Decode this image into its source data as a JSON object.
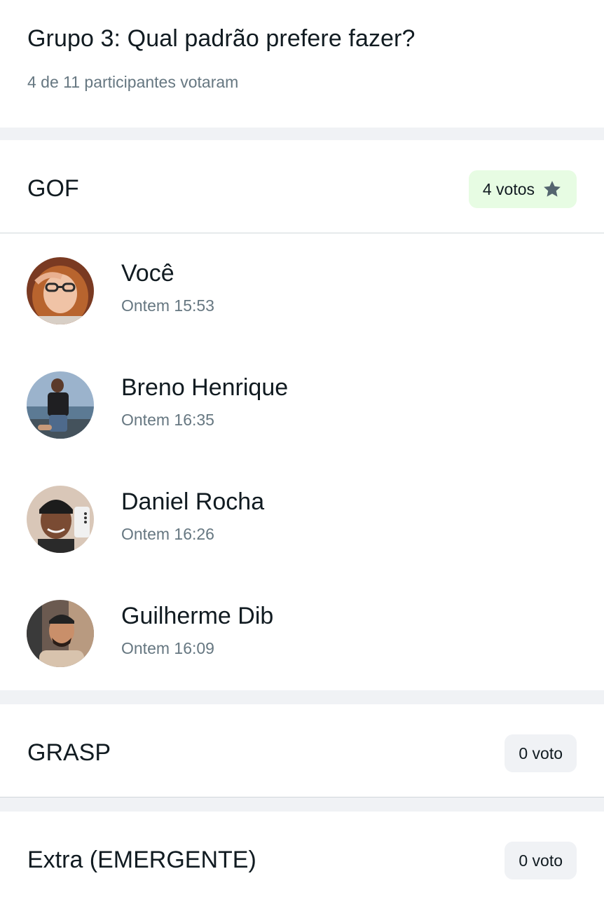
{
  "poll": {
    "question": "Grupo 3: Qual padrão prefere fazer?",
    "participation": "4 de 11 participantes votaram"
  },
  "options": [
    {
      "label": "GOF",
      "votes_text": "4 votos",
      "winner": true,
      "icon": "star-icon",
      "voters": [
        {
          "name": "Você",
          "time": "Ontem 15:53"
        },
        {
          "name": "Breno Henrique",
          "time": "Ontem 16:35"
        },
        {
          "name": "Daniel Rocha",
          "time": "Ontem 16:26"
        },
        {
          "name": "Guilherme Dib",
          "time": "Ontem 16:09"
        }
      ]
    },
    {
      "label": "GRASP",
      "votes_text": "0 voto",
      "winner": false
    },
    {
      "label": "Extra (EMERGENTE)",
      "votes_text": "0 voto",
      "winner": false
    }
  ],
  "colors": {
    "winner_badge_bg": "#e7fce3",
    "plain_badge_bg": "#f0f2f5",
    "section_gap": "#f0f2f5",
    "primary_text": "#111b21",
    "secondary_text": "#667781",
    "star": "#54656f"
  }
}
